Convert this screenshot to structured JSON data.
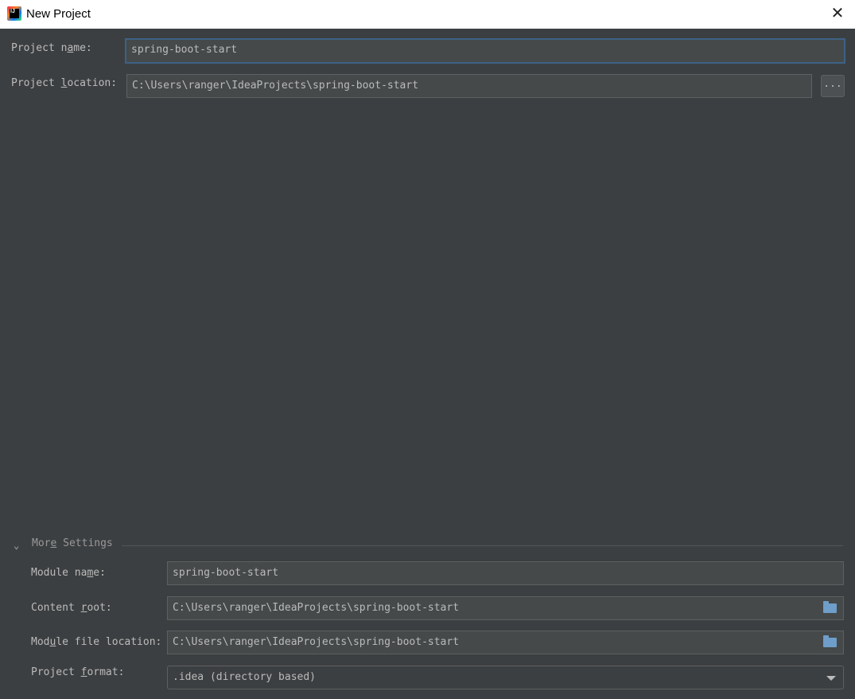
{
  "window": {
    "title": "New Project",
    "close_icon": "close-icon"
  },
  "project_name": {
    "label": [
      "Project n",
      "a",
      "me:"
    ],
    "value": "spring-boot-start"
  },
  "project_location": {
    "label": [
      "Project ",
      "l",
      "ocation:"
    ],
    "value": "C:\\Users\\ranger\\IdeaProjects\\spring-boot-start",
    "browse_label": "..."
  },
  "more_settings": {
    "label": [
      "Mor",
      "e",
      " Settings"
    ],
    "module_name": {
      "label": [
        "Module na",
        "m",
        "e:"
      ],
      "value": "spring-boot-start"
    },
    "content_root": {
      "label": [
        "Content ",
        "r",
        "oot:"
      ],
      "value": "C:\\Users\\ranger\\IdeaProjects\\spring-boot-start"
    },
    "module_file_location": {
      "label": [
        "Mod",
        "u",
        "le file location:"
      ],
      "value": "C:\\Users\\ranger\\IdeaProjects\\spring-boot-start"
    },
    "project_format": {
      "label": [
        "Project ",
        "f",
        "ormat:"
      ],
      "value": ".idea (directory based)"
    }
  }
}
